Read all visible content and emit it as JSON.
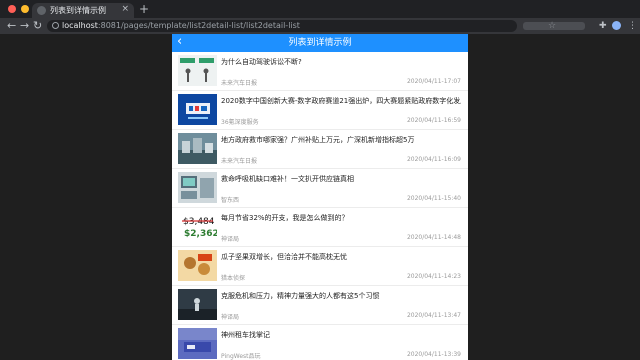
{
  "browser": {
    "tab_title": "列表到详情示例",
    "tab_close": "×",
    "new_tab": "+",
    "url_host": "localhost",
    "url_path": ":8081/pages/template/list2detail-list/list2detail-list",
    "icons": [
      "back-icon",
      "forward-icon",
      "reload-icon",
      "lock-icon",
      "star-icon",
      "puzzle-icon",
      "avatar-icon",
      "menu-icon"
    ]
  },
  "page": {
    "title": "列表到详情示例",
    "back": "‹",
    "header_color": "#1e90ff"
  },
  "items": [
    {
      "title": "为什么自动驾驶诉讼不断?",
      "source": "未来汽车日报",
      "time": "2020/04/11-17:07"
    },
    {
      "title": "2020数字中国创新大赛-数字政府赛道21强出炉，四大赛题紧贴政府数字化发展需求",
      "source": "36氪深度服务",
      "time": "2020/04/11-16:59"
    },
    {
      "title": "地方政府救市哪家强？广州补贴上万元，广深机新增指标超5万",
      "source": "未来汽车日报",
      "time": "2020/04/11-16:09"
    },
    {
      "title": "救命呼吸机缺口难补！一文扒开供应链真相",
      "source": "智东西",
      "time": "2020/04/11-15:40"
    },
    {
      "title": "每月节省32%的开支，我是怎么做到的？",
      "source": "神译局",
      "time": "2020/04/11-14:48"
    },
    {
      "title": "瓜子坚果双增长，但洽洽并不能高枕无忧",
      "source": "猎本侦探",
      "time": "2020/04/11-14:23"
    },
    {
      "title": "克服危机和压力，精神力量强大的人都有这5个习惯",
      "source": "神译局",
      "time": "2020/04/11-13:47"
    },
    {
      "title": "神州租车找掌记",
      "source": "PingWest品玩",
      "time": "2020/04/11-13:39"
    }
  ]
}
